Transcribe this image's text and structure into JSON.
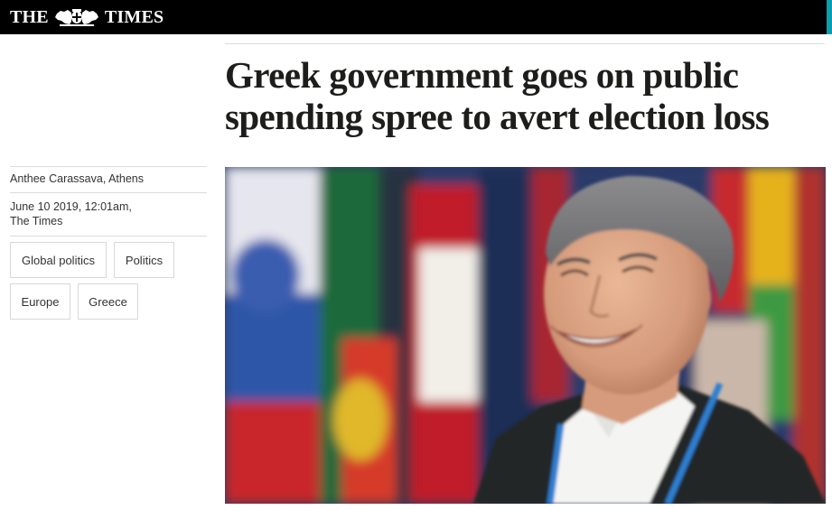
{
  "header": {
    "masthead_left": "THE",
    "masthead_right": "TIMES",
    "crest_icon": "royal-crest-icon",
    "background_color": "#000000",
    "accent_color": "#0a9fb0"
  },
  "article": {
    "headline": "Greek government goes on public spending spree to avert election loss",
    "byline": "Anthee Carassava, Athens",
    "date": "June 10 2019, 12:01am,",
    "source": "The Times",
    "tags": [
      "Global politics",
      "Politics",
      "Europe",
      "Greece"
    ],
    "image": {
      "subject": "smiling-man-photo",
      "lanyard_color": "#2f7fd0"
    }
  }
}
